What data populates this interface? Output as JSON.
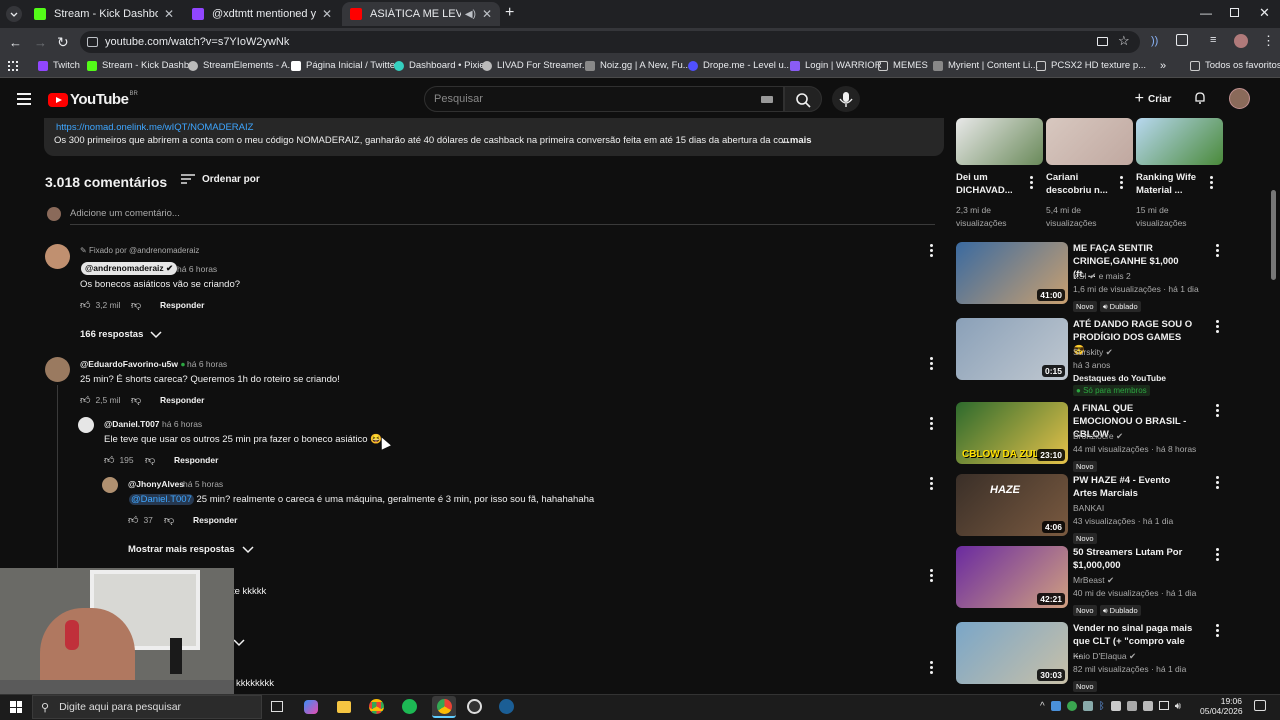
{
  "browser": {
    "tabs": [
      {
        "title": "Stream - Kick Dashboard",
        "color": "#53fc18"
      },
      {
        "title": "@xdtmtt mentioned you",
        "color": "#9146ff"
      },
      {
        "title": "ASIÁTICA ME LEVOU AO CI",
        "color": "#ff0000"
      }
    ],
    "new_tab": "+",
    "url": "youtube.com/watch?v=s7YIoW2ywNk",
    "bookmarks": [
      {
        "label": "Twitch",
        "color": "#9146ff"
      },
      {
        "label": "Stream - Kick Dashb...",
        "color": "#53fc18"
      },
      {
        "label": "StreamElements - A...",
        "color": "#bbbbbb"
      },
      {
        "label": "Página Inicial / Twitter",
        "color": "#ffffff"
      },
      {
        "label": "Dashboard • Pixie",
        "color": "#35d0c0"
      },
      {
        "label": "LIVAD For Streamer...",
        "color": "#bbbbbb"
      },
      {
        "label": "Noiz.gg | A New, Fu...",
        "color": "#888888"
      },
      {
        "label": "Drope.me - Level u...",
        "color": "#5050ff"
      },
      {
        "label": "Login | WARRIOR",
        "color": "#8a5cf6"
      },
      {
        "label": "MEMES",
        "color": "#cccccc"
      },
      {
        "label": "Myrient | Content Li...",
        "color": "#888888"
      },
      {
        "label": "PCSX2 HD texture p...",
        "color": "#cccccc"
      }
    ],
    "all_bookmarks": "Todos os favoritos"
  },
  "youtube": {
    "logo": "YouTube",
    "country": "BR",
    "search_placeholder": "Pesquisar",
    "create": "Criar"
  },
  "description": {
    "link": "https://nomad.onelink.me/wIQT/NOMADERAIZ",
    "text": "Os 300 primeiros que abrirem a conta com o meu código NOMADERAIZ, ganharão até 40 dólares de cashback na primeira conversão feita em até 15 dias da abertura da conta.",
    "more": "...mais"
  },
  "comments_header": {
    "count": "3.018 comentários",
    "sort": "Ordenar por",
    "add_placeholder": "Adicione um comentário..."
  },
  "comments": {
    "pinned": {
      "pinned_label": "Fixado por @andrenomaderaiz",
      "author": "@andrenomaderaiz",
      "time": "há 6 horas",
      "text": "Os bonecos asiáticos vão se criando?",
      "likes": "3,2 mil",
      "reply": "Responder",
      "replies": "166 respostas"
    },
    "c2": {
      "author": "@EduardoFavorino-u5w",
      "time": "há 6 horas",
      "text": "25 min? É shorts careca? Queremos 1h do roteiro se criando!",
      "likes": "2,5 mil",
      "reply": "Responder"
    },
    "r1": {
      "author": "@Daniel.T007",
      "time": "há 6 horas",
      "text": "Ele teve que usar os outros 25 min pra fazer o boneco asiático 😆",
      "likes": "195",
      "reply": "Responder"
    },
    "r2": {
      "author": "@JhonyAlves",
      "time": "há 5 horas",
      "mention": "@Daniel.T007",
      "text": "25 min? realmente o careca é uma máquina, geralmente é 3 min, por isso sou fã, hahahahaha",
      "likes": "37",
      "reply": "Responder"
    },
    "more_replies": "Mostrar mais respostas",
    "partial1": "te kkkkk",
    "partial2": "kkkkkkkk"
  },
  "related_top": [
    {
      "title": "Dei um DICHAVAD...",
      "views": "2,3 mi de visualizações"
    },
    {
      "title": "Cariani descobriu n...",
      "views": "5,4 mi de visualizações"
    },
    {
      "title": "Ranking Wife Material ...",
      "views": "15 mi de visualizações"
    }
  ],
  "related": [
    {
      "title": "ME FAÇA SENTIR CRINGE,GANHE $1,000 (ft. ...",
      "channel": "KSI",
      "extra": "e mais 2",
      "meta": "1,6 mi de visualizações · há 1 dia",
      "duration": "41:00",
      "badges": [
        "Novo",
        "Dublado"
      ],
      "colors": [
        "#3a6aa0",
        "#c9a070"
      ]
    },
    {
      "title": "ATÉ DANDO RAGE SOU O PRODÍGIO DOS GAMES 😎",
      "channel": "Surskity",
      "meta": "há 3 anos",
      "meta2": "Destaques do YouTube",
      "members": "Só para membros",
      "duration": "0:15",
      "colors": [
        "#8aa0b8",
        "#c0c8d0"
      ]
    },
    {
      "title": "A FINAL QUE EMOCIONOU O BRASIL - CBLOW",
      "channel": "Bronziocre",
      "meta": "44 mil visualizações · há 8 horas",
      "duration": "23:10",
      "overlay": "CBLOW DA ZUL",
      "badges": [
        "Novo"
      ],
      "colors": [
        "#2d6a2d",
        "#e6c24a"
      ]
    },
    {
      "title": "PW HAZE #4 - Evento Artes Marciais",
      "channel": "BANKAI",
      "meta": "43 visualizações · há 1 dia",
      "duration": "4:06",
      "overlay": "HAZE",
      "badges": [
        "Novo"
      ],
      "colors": [
        "#3a2f28",
        "#7a5a40"
      ]
    },
    {
      "title": "50 Streamers Lutam Por $1,000,000",
      "channel": "MrBeast",
      "meta": "40 mi de visualizações · há 1 dia",
      "duration": "42:21",
      "badges": [
        "Novo",
        "Dublado"
      ],
      "colors": [
        "#6a2aa0",
        "#d0a080"
      ]
    },
    {
      "title": "Vender no sinal paga mais que CLT (+ \"compro vale ...",
      "channel": "Kaio D'Elaqua",
      "meta": "82 mil visualizações · há 1 dia",
      "duration": "30:03",
      "badges": [
        "Novo"
      ],
      "colors": [
        "#7aa6c8",
        "#c8c0a8"
      ]
    }
  ],
  "taskbar": {
    "search": "Digite aqui para pesquisar",
    "time": "19:06",
    "date": "05/04/2026"
  }
}
